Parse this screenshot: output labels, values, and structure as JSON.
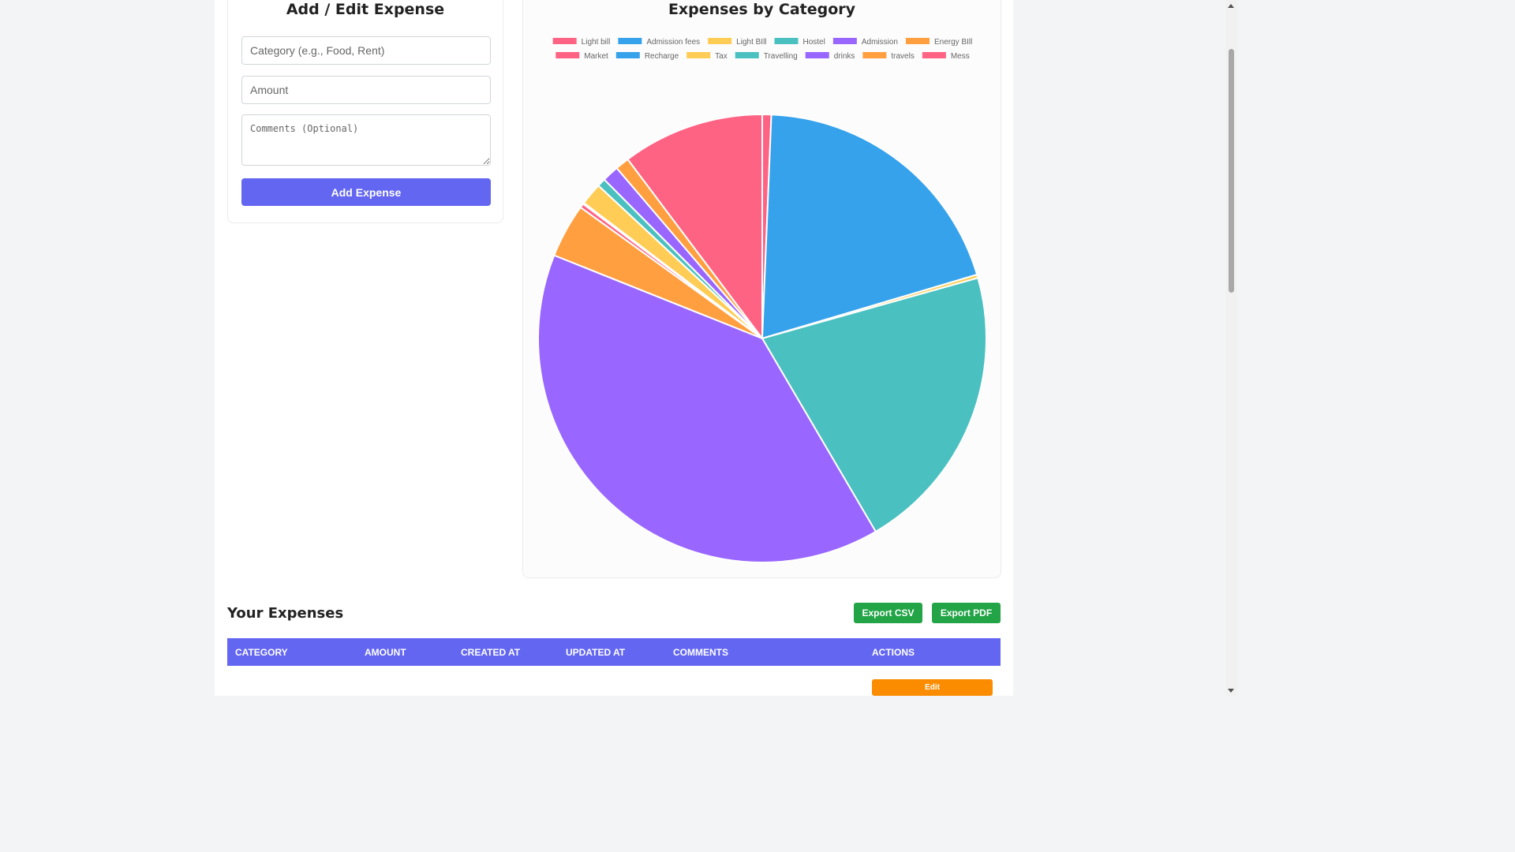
{
  "form": {
    "title": "Add / Edit Expense",
    "category_placeholder": "Category (e.g., Food, Rent)",
    "amount_placeholder": "Amount",
    "comments_placeholder": "Comments (Optional)",
    "submit_label": "Add Expense"
  },
  "chart_title": "Expenses by Category",
  "chart_data": {
    "type": "pie",
    "title": "Expenses by Category",
    "legend_position": "top",
    "slices": [
      {
        "label": "Light bill",
        "value": 0.65,
        "color": "#ff6384"
      },
      {
        "label": "Admission fees",
        "value": 19.75,
        "color": "#36a2eb"
      },
      {
        "label": "Light BIll",
        "value": 0.25,
        "color": "#ffcd56"
      },
      {
        "label": "Hostel",
        "value": 20.9,
        "color": "#4bc0c0"
      },
      {
        "label": "Admission",
        "value": 39.5,
        "color": "#9966ff"
      },
      {
        "label": "Energy BIll",
        "value": 3.9,
        "color": "#ff9f40"
      },
      {
        "label": "Market",
        "value": 0.3,
        "color": "#ff6384"
      },
      {
        "label": "Recharge",
        "value": 0.1,
        "color": "#36a2eb"
      },
      {
        "label": "Tax",
        "value": 1.6,
        "color": "#ffcd56"
      },
      {
        "label": "Travelling",
        "value": 0.6,
        "color": "#4bc0c0"
      },
      {
        "label": "drinks",
        "value": 1.2,
        "color": "#9966ff"
      },
      {
        "label": "travels",
        "value": 1.0,
        "color": "#ff9f40"
      },
      {
        "label": "Mess",
        "value": 10.25,
        "color": "#ff6384"
      }
    ]
  },
  "table": {
    "title": "Your Expenses",
    "export_csv": "Export CSV",
    "export_pdf": "Export PDF",
    "headers": [
      "Category",
      "Amount",
      "Created At",
      "Updated At",
      "Comments",
      "Actions"
    ],
    "edit_label": "Edit"
  },
  "colors": {
    "primary": "#6366f1",
    "export": "#22a447",
    "edit": "#fb8c00"
  }
}
